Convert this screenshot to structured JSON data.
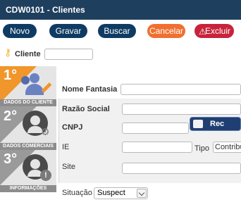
{
  "window": {
    "title": "CDW0101 - Clientes"
  },
  "toolbar": {
    "novo": "Novo",
    "gravar": "Gravar",
    "buscar": "Buscar",
    "cancelar": "Cancelar",
    "excluir": "Excluir"
  },
  "cliente": {
    "label": "Cliente",
    "value": ""
  },
  "steps": [
    {
      "number": "1°",
      "caption": "DADOS DO CLIENTE",
      "color": "#f0962a"
    },
    {
      "number": "2°",
      "caption": "DADOS COMERCIAIS",
      "color": "#9a9a9a"
    },
    {
      "number": "3°",
      "caption": "INFORMAÇÕES",
      "color": "#9a9a9a"
    }
  ],
  "form": {
    "nome_fantasia_label": "Nome Fantasia",
    "razao_social_label": "Razão Social",
    "cnpj_label": "CNPJ",
    "receita_label": "Rec",
    "ie_label": "IE",
    "tipo_label": "Tipo",
    "tipo_value": "Contribu",
    "site_label": "Site",
    "situacao_label": "Situação",
    "situacao_value": "Suspect"
  }
}
